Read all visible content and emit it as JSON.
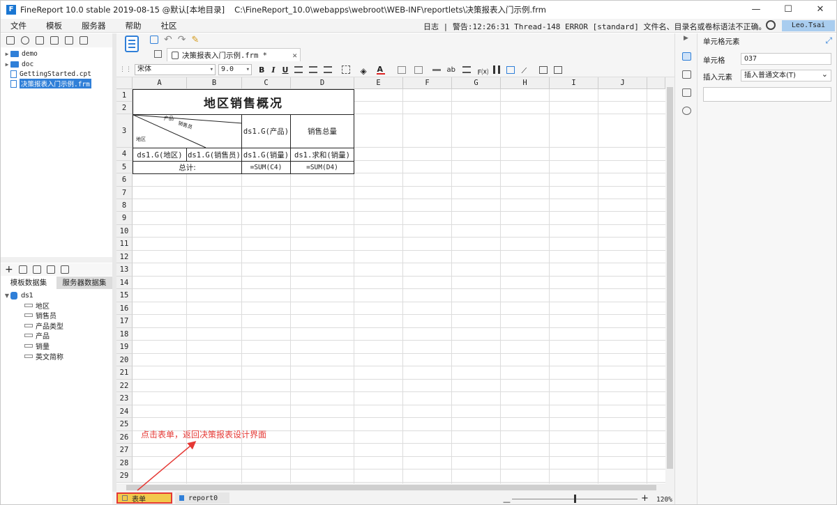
{
  "titlebar": {
    "app_title": "FineReport 10.0 stable 2019-08-15 @默认[本地目录]",
    "path": "C:\\FineReport_10.0\\webapps\\webroot\\WEB-INF\\reportlets\\决策报表入门示例.frm",
    "minimize": "—",
    "maximize": "☐",
    "close": "✕"
  },
  "menubar": {
    "items": [
      "文件",
      "模板",
      "服务器",
      "帮助",
      "社区"
    ],
    "log_text": "日志 | 警告:12:26:31 Thread-148 ERROR [standard] 文件名、目录名或卷标语法不正确。",
    "user": "Leo.Tsai"
  },
  "filetree": {
    "items": [
      {
        "name": "demo",
        "type": "folder"
      },
      {
        "name": "doc",
        "type": "folder"
      },
      {
        "name": "GettingStarted.cpt",
        "type": "file"
      },
      {
        "name": "决策报表入门示例.frm",
        "type": "file",
        "selected": true
      }
    ]
  },
  "datasets": {
    "tabs": [
      "模板数据集",
      "服务器数据集"
    ],
    "dataset_name": "ds1",
    "fields": [
      "地区",
      "销售员",
      "产品类型",
      "产品",
      "销量",
      "英文简称"
    ]
  },
  "editor": {
    "file_tab": "决策报表入门示例.frm *",
    "file_tab_close": "✕",
    "font_name": "宋体",
    "font_size": "9.0",
    "bold": "B",
    "italic": "I",
    "underline": "U",
    "columns": [
      "A",
      "B",
      "C",
      "D",
      "E",
      "F",
      "G",
      "H",
      "I",
      "J"
    ],
    "rows": [
      "1",
      "2",
      "3",
      "4",
      "5",
      "6",
      "7",
      "8",
      "9",
      "10",
      "11",
      "12",
      "13",
      "14",
      "15",
      "16",
      "17",
      "18",
      "19",
      "20",
      "21",
      "22",
      "23",
      "24",
      "25",
      "26",
      "27",
      "28",
      "29"
    ],
    "cells": {
      "title": "地区销售概况",
      "diag_product": "产品",
      "diag_sales": "销售员",
      "diag_region": "地区",
      "c3": "ds1.G(产品)",
      "d3": "销售总量",
      "a4": "ds1.G(地区)",
      "b4": "ds1.G(销售员)",
      "c4": "ds1.G(销量)",
      "d4": "ds1.求和(销量)",
      "a5": "总计:",
      "c5": "=SUM(C4)",
      "d5": "=SUM(D4)"
    }
  },
  "sheets": {
    "form": "表单",
    "report": "report0"
  },
  "zoom": {
    "minus": "—",
    "plus": "+",
    "percent": "120%",
    "level": 0.5
  },
  "annotation": "点击表单，返回决策报表设计界面",
  "right_panel": {
    "title": "单元格元素",
    "cell_label": "单元格",
    "cell_value": "O37",
    "insert_label": "插入元素",
    "insert_value": "插入普通文本(T)"
  },
  "colors": {
    "accent": "#2f7fd8",
    "annotation": "#e53935",
    "form_tab": "#f2c94c"
  }
}
